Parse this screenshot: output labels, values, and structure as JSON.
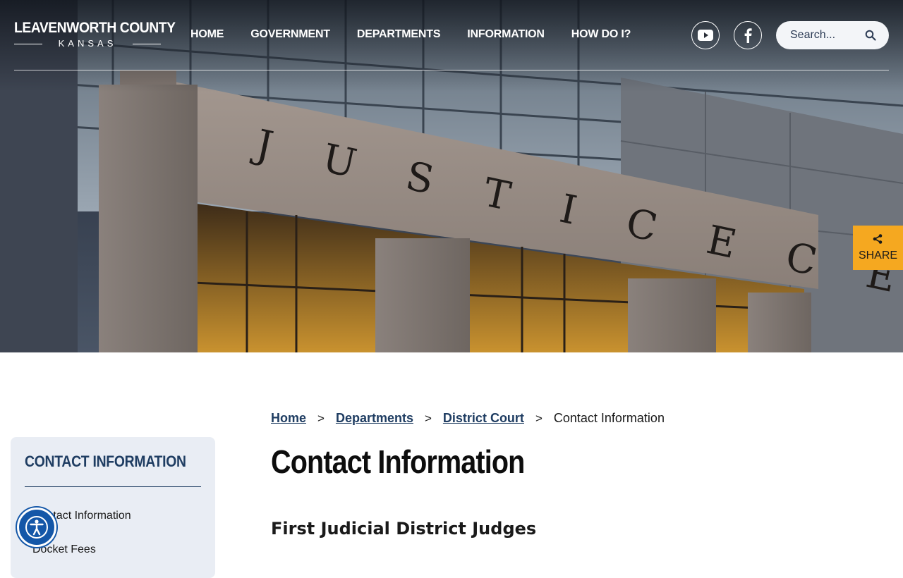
{
  "header": {
    "logo_title": "LEAVENWORTH COUNTY",
    "logo_subtitle": "KANSAS",
    "nav": [
      {
        "label": "HOME"
      },
      {
        "label": "GOVERNMENT"
      },
      {
        "label": "DEPARTMENTS"
      },
      {
        "label": "INFORMATION"
      },
      {
        "label": "HOW DO I?"
      }
    ],
    "social": [
      {
        "icon": "youtube-icon"
      },
      {
        "icon": "facebook-icon"
      }
    ],
    "search": {
      "placeholder": "Search...",
      "icon": "search-icon"
    }
  },
  "hero": {
    "engraving": "J U S T I C E   C E N T E R"
  },
  "share": {
    "label": "SHARE",
    "icon": "share-icon",
    "color": "#f5a820"
  },
  "sidebar": {
    "title": "CONTACT INFORMATION",
    "items": [
      {
        "label": "Contact Information"
      },
      {
        "label": "Docket Fees"
      }
    ]
  },
  "accessibility": {
    "icon": "accessibility-icon",
    "color": "#1457a8"
  },
  "breadcrumb": {
    "items": [
      {
        "label": "Home"
      },
      {
        "label": "Departments"
      },
      {
        "label": "District Court"
      }
    ],
    "separator": ">",
    "current": "Contact Information"
  },
  "main": {
    "title": "Contact Information",
    "section_heading": "First Judicial District Judges"
  },
  "colors": {
    "brand_navy": "#1f3d62",
    "share_orange": "#f5a820",
    "sidebar_bg": "#e9edf4"
  }
}
